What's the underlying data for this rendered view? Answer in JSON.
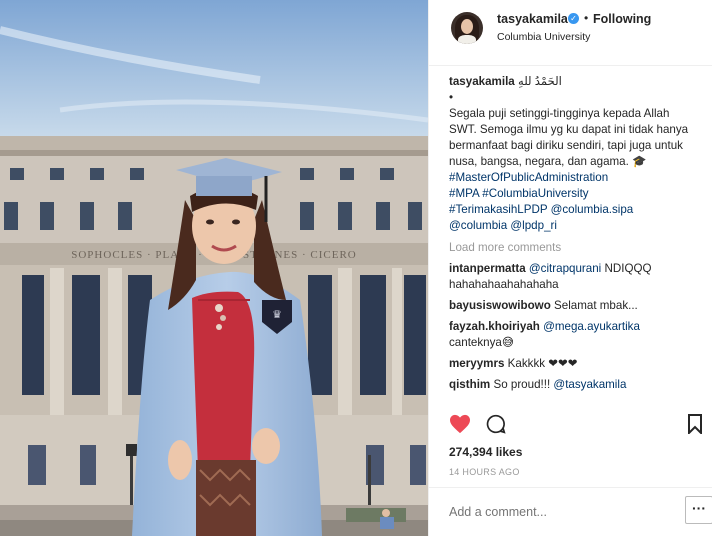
{
  "post": {
    "username": "tasyakamila",
    "verified_label": "✓",
    "separator": "•",
    "follow_status": "Following",
    "location": "Columbia University"
  },
  "caption": {
    "username": "tasyakamila",
    "arabic": "الحَمْدُ للهِ",
    "bullet": "•",
    "text": "Segala puji setinggi-tingginya kepada Allah SWT. Semoga ilmu yg ku dapat ini tidak hanya bermanfaat bagi diriku sendiri, tapi juga untuk nusa, bangsa, negara, dan agama. ",
    "emoji": "🎓",
    "tags_line1": "#MasterOfPublicAdministration",
    "tags_line2": "#MPA #ColumbiaUniversity",
    "tags_line3": "#TerimakasihLPDP @columbia.sipa",
    "tags_line4": "@columbia @lpdp_ri"
  },
  "load_more": "Load more comments",
  "comments": [
    {
      "user": "intanpermatta",
      "mention": "@citrapqurani",
      "text": " NDIQQQ hahahahaahahahaha"
    },
    {
      "user": "bayusiswowibowo",
      "mention": "",
      "text": "Selamat mbak..."
    },
    {
      "user": "fayzah.khoiriyah",
      "mention": "@mega.ayukartika",
      "text": " canteknya😅"
    },
    {
      "user": "meryymrs",
      "mention": "",
      "text": "Kakkkk ❤❤❤"
    },
    {
      "user": "qisthim",
      "mention": "@tasyakamila",
      "text": "So proud!!! "
    }
  ],
  "icons": {
    "heart": "heart-icon",
    "comment": "comment-icon",
    "bookmark": "bookmark-icon",
    "more": "more-options-icon"
  },
  "colors": {
    "heart_red": "#ed4956",
    "link_blue": "#003569",
    "verified_blue": "#3897f0"
  },
  "likes": "274,394 likes",
  "timestamp": "14 HOURS AGO",
  "add_comment": {
    "placeholder": "Add a comment...",
    "more_label": "···"
  },
  "photo": {
    "inscription": "SOPHOCLES · PLATO · DEMOSTHENES · CICERO"
  }
}
